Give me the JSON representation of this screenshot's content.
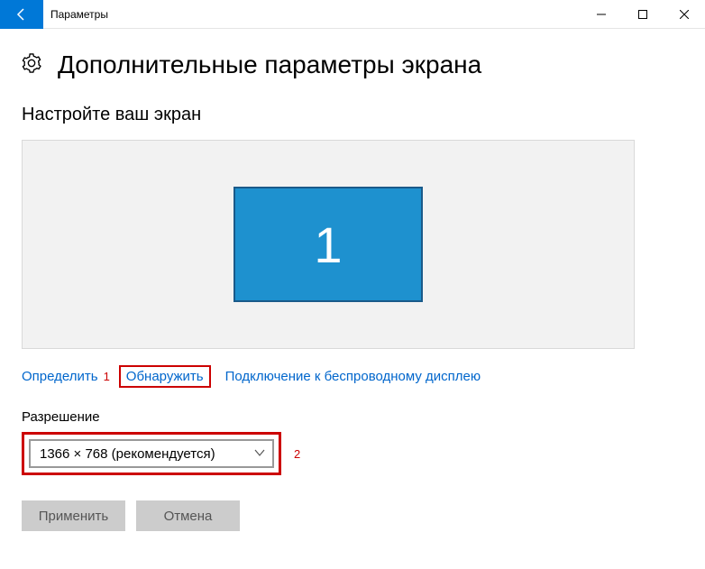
{
  "titlebar": {
    "app_title": "Параметры"
  },
  "page": {
    "title": "Дополнительные параметры экрана",
    "section_title": "Настройте ваш экран"
  },
  "monitor": {
    "number": "1"
  },
  "links": {
    "identify": "Определить",
    "detect": "Обнаружить",
    "wireless": "Подключение к беспроводному дисплею"
  },
  "resolution": {
    "label": "Разрешение",
    "value": "1366 × 768 (рекомендуется)"
  },
  "buttons": {
    "apply": "Применить",
    "cancel": "Отмена"
  },
  "annotations": {
    "a1": "1",
    "a2": "2"
  }
}
